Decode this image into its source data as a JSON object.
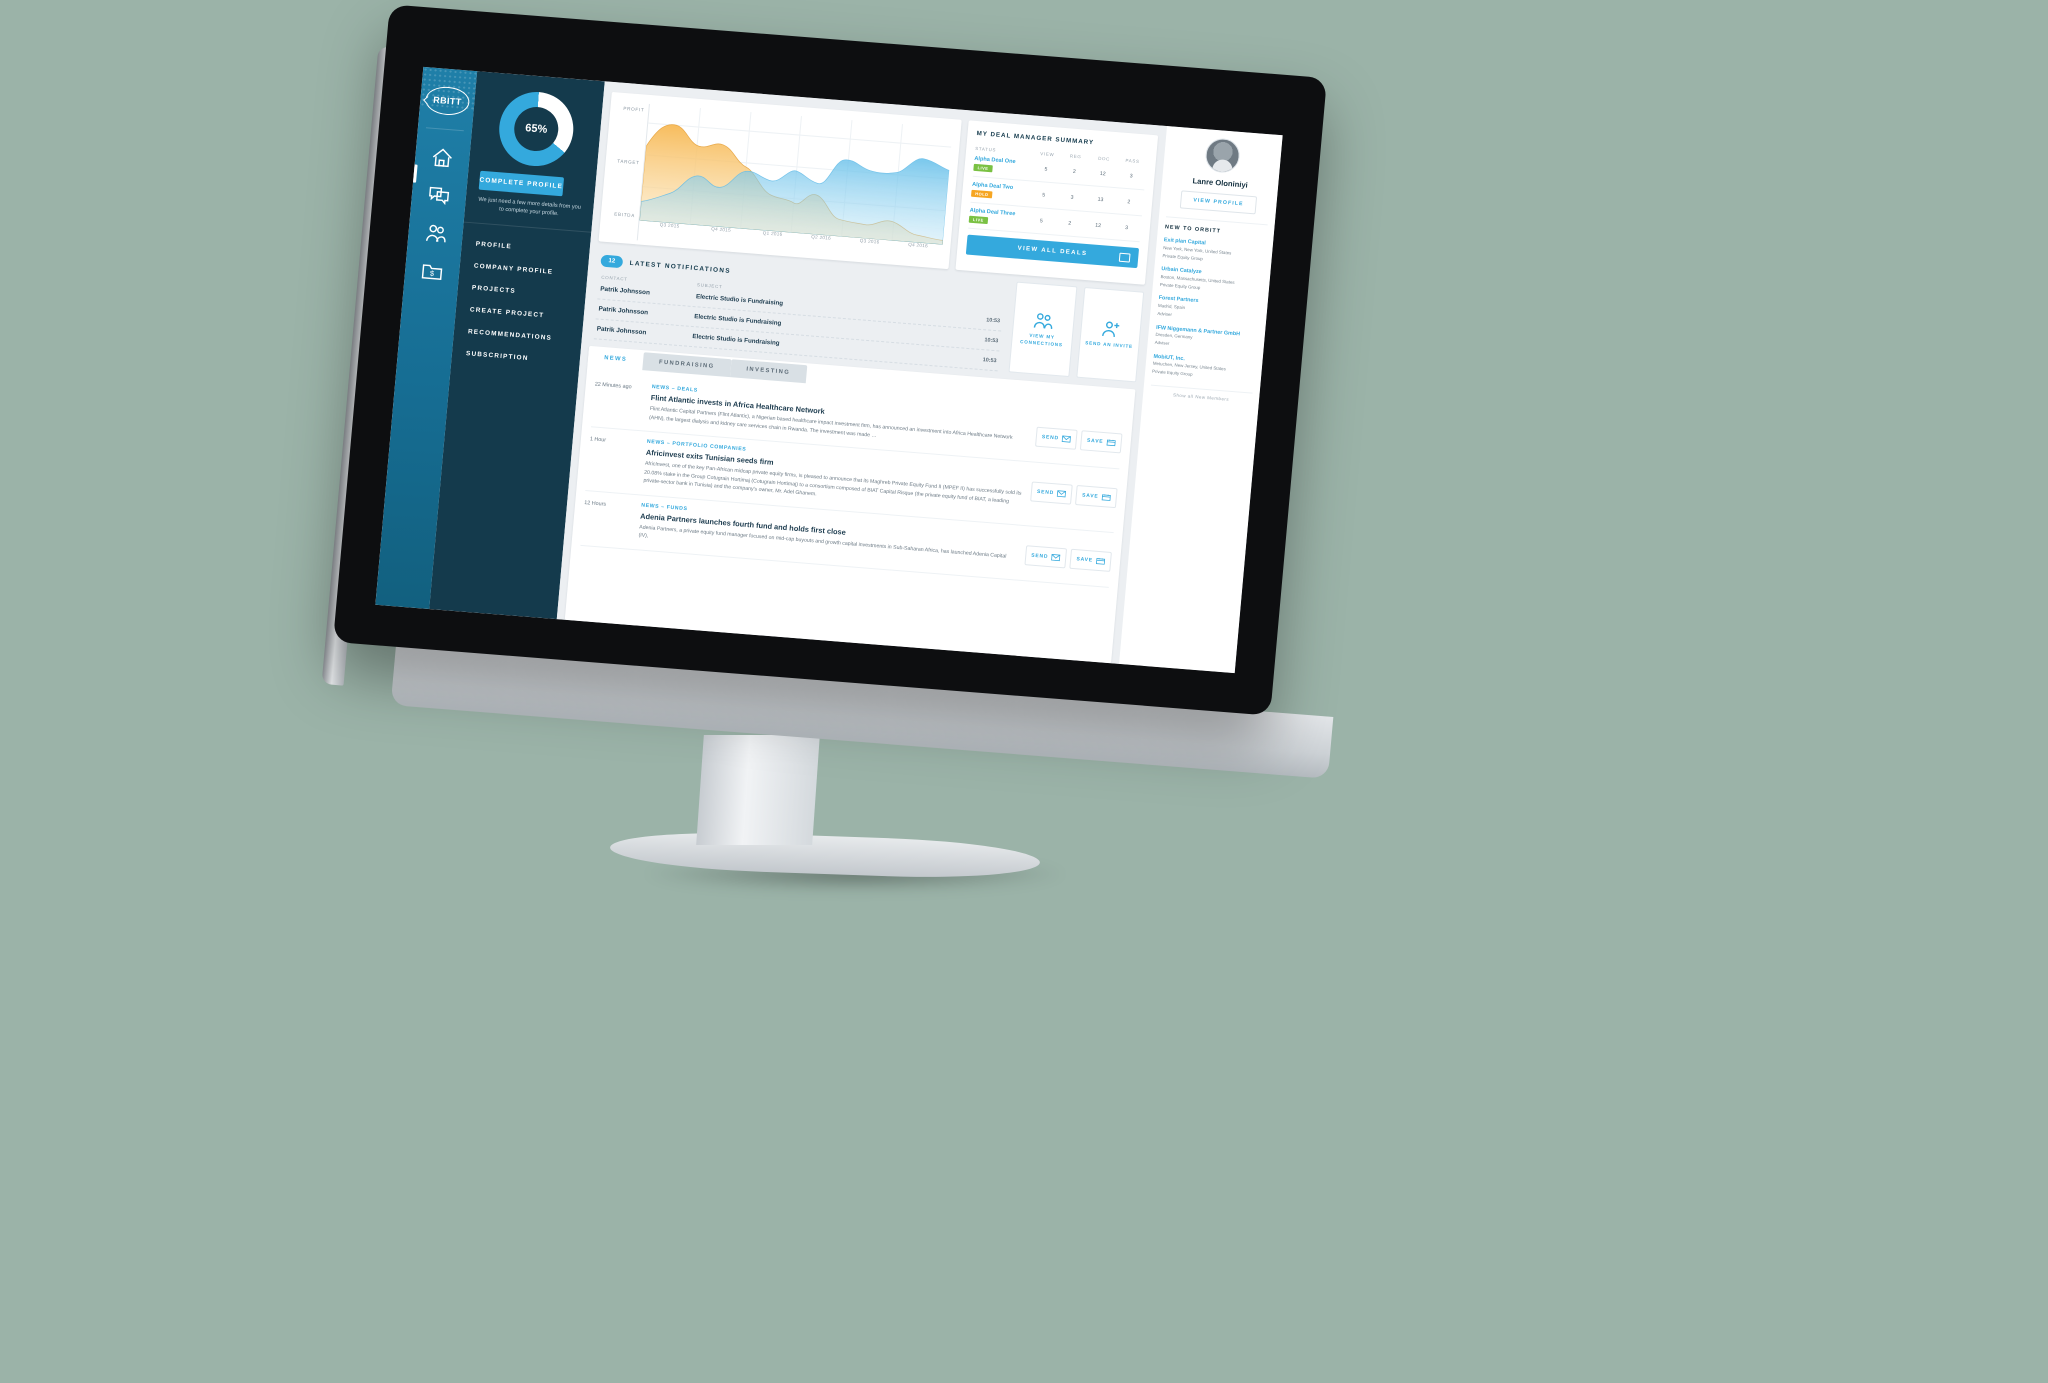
{
  "brand": {
    "logo_text": "RBITT",
    "accent": "#34a9dd",
    "sidebar_bg": "#143a4c",
    "rail_bg": "#1f7fa8"
  },
  "rail": {
    "icons": [
      {
        "name": "home-icon",
        "label": "Home"
      },
      {
        "name": "messages-icon",
        "label": "Messages"
      },
      {
        "name": "connections-icon",
        "label": "Connections"
      },
      {
        "name": "deals-folder-icon",
        "label": "Deals"
      }
    ]
  },
  "sidebar": {
    "profile_percent": "65%",
    "profile_percent_value": 65,
    "cta_label": "COMPLETE PROFILE",
    "cta_note": "We just need a few more details from you to complete your profile.",
    "nav": [
      {
        "label": "PROFILE"
      },
      {
        "label": "COMPANY PROFILE"
      },
      {
        "label": "PROJECTS"
      },
      {
        "label": "CREATE PROJECT"
      },
      {
        "label": "RECOMMENDATIONS"
      },
      {
        "label": "SUBSCRIPTION"
      }
    ]
  },
  "chart_data": {
    "type": "area",
    "title": "",
    "xlabel": "",
    "ylabel": "",
    "categories": [
      "Q3 2015",
      "Q4 2015",
      "Q1 2016",
      "Q2 2016",
      "Q3 2016",
      "Q4 2016"
    ],
    "ytick_labels": [
      "PROFIT",
      "TARGET",
      "EBITDA"
    ],
    "grid": true,
    "legend_position": "none",
    "series": [
      {
        "name": "Target",
        "color": "#f4b martians",
        "fill": "#f7c872",
        "values": [
          72,
          80,
          74,
          62,
          66,
          58,
          40,
          26,
          20,
          18,
          30,
          22,
          14,
          12,
          10,
          8,
          16,
          10,
          6,
          4
        ]
      },
      {
        "name": "EBITDA",
        "color": "#5bbbe8",
        "fill": "#7fc9ec",
        "values": [
          18,
          20,
          26,
          34,
          40,
          34,
          30,
          46,
          42,
          50,
          48,
          40,
          38,
          52,
          50,
          48,
          62,
          54,
          58,
          56
        ]
      }
    ]
  },
  "deal_summary": {
    "title": "MY DEAL MANAGER SUMMARY",
    "columns": [
      "STATUS",
      "VIEW",
      "REG",
      "DOC",
      "PASS"
    ],
    "rows": [
      {
        "name": "Alpha Deal One",
        "status": "LIVE",
        "view": "5",
        "reg": "2",
        "doc": "12",
        "pass": "3"
      },
      {
        "name": "Alpha Deal Two",
        "status": "HOLD",
        "view": "5",
        "reg": "3",
        "doc": "13",
        "pass": "2"
      },
      {
        "name": "Alpha Deal Three",
        "status": "LIVE",
        "view": "5",
        "reg": "2",
        "doc": "12",
        "pass": "3"
      }
    ],
    "view_all_label": "VIEW ALL DEALS"
  },
  "notifications": {
    "count": "12",
    "title": "LATEST NOTIFICATIONS",
    "columns": {
      "contact": "CONTACT",
      "subject": "SUBJECT"
    },
    "rows": [
      {
        "contact": "Patrik Johnsson",
        "subject": "Electric Studio is Fundraising",
        "time": "10:53"
      },
      {
        "contact": "Patrik Johnsson",
        "subject": "Electric Studio is Fundraising",
        "time": "10:53"
      },
      {
        "contact": "Patrik Johnsson",
        "subject": "Electric Studio is Fundraising",
        "time": "10:53"
      }
    ]
  },
  "quick_actions": [
    {
      "name": "view-my-connections",
      "label": "VIEW MY CONNECTIONS",
      "icon": "people-icon"
    },
    {
      "name": "send-an-invite",
      "label": "SEND AN INVITE",
      "icon": "person-plus-icon"
    }
  ],
  "news": {
    "tabs": [
      {
        "label": "NEWS",
        "active": true
      },
      {
        "label": "FUNDRAISING",
        "active": false
      },
      {
        "label": "INVESTING",
        "active": false
      }
    ],
    "items": [
      {
        "time": "22 Minutes ago",
        "category": "NEWS – DEALS",
        "title": "Flint Atlantic invests in Africa Healthcare Network",
        "body": "Flint Atlantic Capital Partners (Flint Atlantic), a Nigerian based healthcare impact investment firm, has announced an investment into Africa Healthcare Network (AHN), the largest dialysis and kidney care services chain in Rwanda. The investment was made …",
        "send_label": "SEND",
        "save_label": "SAVE"
      },
      {
        "time": "1 Hour",
        "category": "NEWS – PORTFOLIO COMPANIES",
        "title": "Africinvest exits Tunisian seeds firm",
        "body": "AfricInvest, one of the key Pan-African midcap private equity firms, is pleased to announce that its Maghreb Private Equity Fund II (MPEF II) has successfully sold its 20.08% stake in the Group Cotugrain Hortimaj (Cotugrain Hortimaj) to a consortium composed of BIAT Capital Risque (the private equity fund of BIAT, a leading private-sector bank in Tunisia) and the company's owner, Mr. Adel Ghanem.",
        "send_label": "SEND",
        "save_label": "SAVE"
      },
      {
        "time": "12 Hours",
        "category": "NEWS – FUNDS",
        "title": "Adenia Partners launches fourth fund and holds first close",
        "body": "Adenia Partners, a private equity fund manager focused on mid-cap buyouts and growth capital investments in Sub-Saharan Africa, has launched Adenia Capital (IV),",
        "send_label": "SEND",
        "save_label": "SAVE"
      }
    ]
  },
  "right_panel": {
    "user_name": "Lanre Oloniniyi",
    "view_profile_label": "VIEW PROFILE",
    "new_members_title": "NEW TO ORBITT",
    "members": [
      {
        "name": "Exit plan Capital",
        "location": "New York, New York, United States",
        "type": "Private Equity Group"
      },
      {
        "name": "Urbain Catalyze",
        "location": "Boston, Massachusetts, United States",
        "type": "Private Equity Group"
      },
      {
        "name": "Forest Partners",
        "location": "Madrid, Spain",
        "type": "Adviser"
      },
      {
        "name": "IFW Niggemann & Partner GmbH",
        "location": "Dresden, Germany",
        "type": "Adviser"
      },
      {
        "name": "MobiUT, Inc.",
        "location": "Metuchen, New Jersey, United States",
        "type": "Private Equity Group"
      }
    ],
    "show_all_label": "Show all New Members"
  }
}
